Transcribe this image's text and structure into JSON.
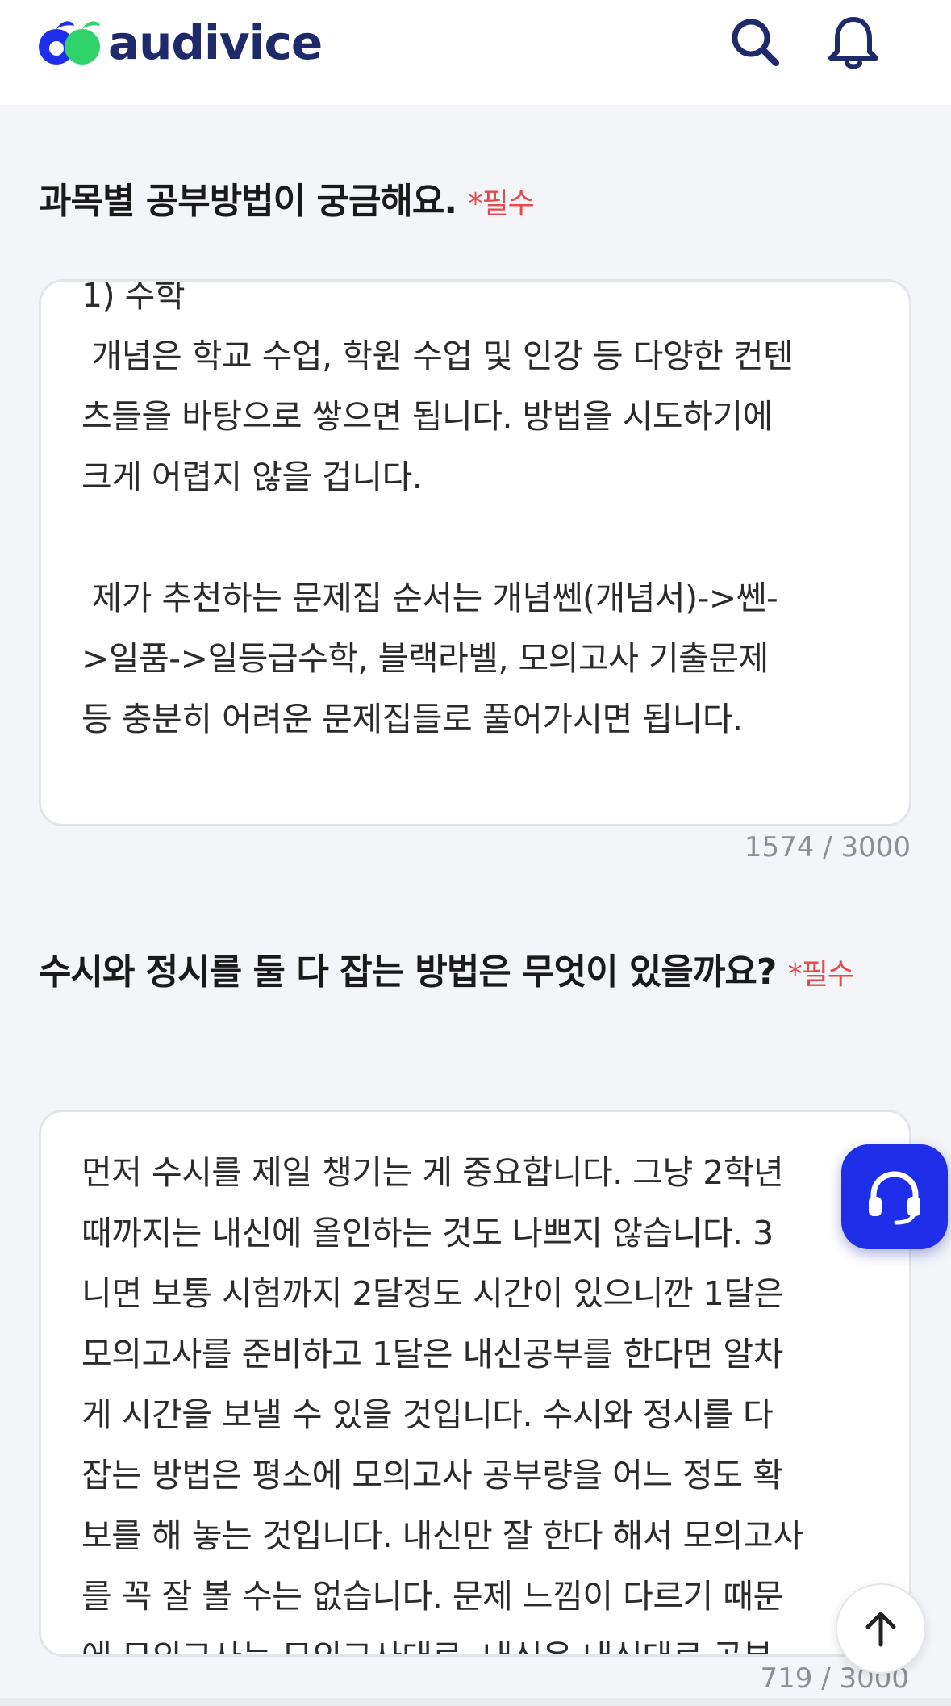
{
  "header": {
    "logo_text": "audivice",
    "search_icon": "search-icon",
    "bell_icon": "bell-icon"
  },
  "colors": {
    "brand_navy": "#1f2a6b",
    "brand_blue": "#1f2ee8",
    "brand_green": "#2fd36a",
    "required_red": "#e5484d"
  },
  "questions": [
    {
      "title": "과목별 공부방법이 궁금해요.",
      "required_label": "*필수",
      "answer": "1) 수학\n 개념은 학교 수업, 학원 수업 및 인강 등 다양한 컨텐\n츠들을 바탕으로 쌓으면 됩니다. 방법을 시도하기에\n크게 어렵지 않을 겁니다.\n\n 제가 추천하는 문제집 순서는 개념쎈(개념서)->쎈-\n>일품->일등급수학, 블랙라벨, 모의고사 기출문제\n등 충분히 어려운 문제집들로 풀어가시면 됩니다.",
      "counter": "1574 / 3000"
    },
    {
      "title": "수시와 정시를 둘 다 잡는 방법은 무엇이 있을까요?",
      "required_label": "*필수",
      "answer": "먼저 수시를 제일 챙기는 게 중요합니다. 그냥 2학년\n때까지는 내신에 올인하는 것도 나쁘지 않습니다. 3\n니면 보통 시험까지 2달정도 시간이 있으니깐 1달은\n모의고사를 준비하고 1달은 내신공부를 한다면 알차\n게 시간을 보낼 수 있을 것입니다. 수시와 정시를 다\n잡는 방법은 평소에 모의고사 공부량을 어느 정도 확\n보를 해 놓는 것입니다. 내신만 잘 한다 해서 모의고사\n를 꼭 잘 볼 수는 없습니다. 문제 느낌이 다르기 때문\n에 모의고사는 모의고사대로, 내신은 내신대로 공부",
      "counter": "719 / 3000"
    }
  ],
  "fab": {
    "support_icon": "headset-icon",
    "top_icon": "arrow-up-icon"
  }
}
